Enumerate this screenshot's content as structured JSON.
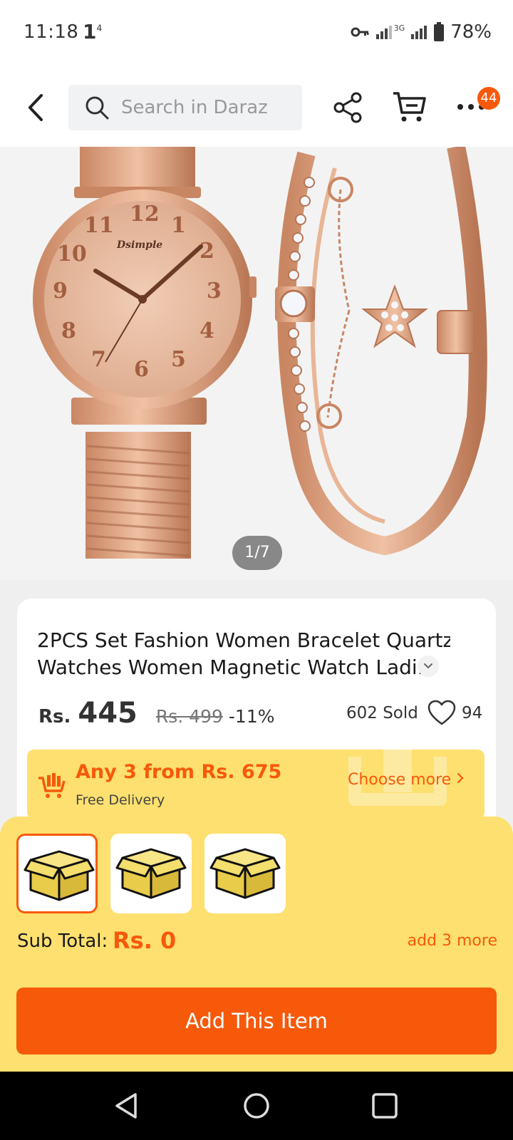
{
  "status_bar": {
    "time": "11:18",
    "extra_icon": "1",
    "extra_sup": "4",
    "network_label": "3G",
    "battery": "78%"
  },
  "header": {
    "search_placeholder": "Search in Daraz",
    "cart_badge": "44"
  },
  "gallery": {
    "counter": "1/7",
    "watch_brand": "Dsimple"
  },
  "product": {
    "title_line1": "2PCS Set Fashion Women Bracelet Quartz",
    "title_line2": "Watches Women Magnetic Watch Ladi...",
    "currency": "Rs.",
    "price": "445",
    "old_price": "Rs. 499",
    "discount": "-11%",
    "sold": "602 Sold",
    "likes": "94"
  },
  "promo": {
    "title": "Any 3 from Rs. 675",
    "subtitle": "Free Delivery",
    "link": "Choose more"
  },
  "bundle": {
    "subtotal_label": "Sub Total:",
    "subtotal_value": "Rs. 0",
    "add_more": "add 3 more",
    "add_button": "Add This Item"
  },
  "colors": {
    "accent": "#f7590b",
    "promo_bg": "#fde06f"
  }
}
